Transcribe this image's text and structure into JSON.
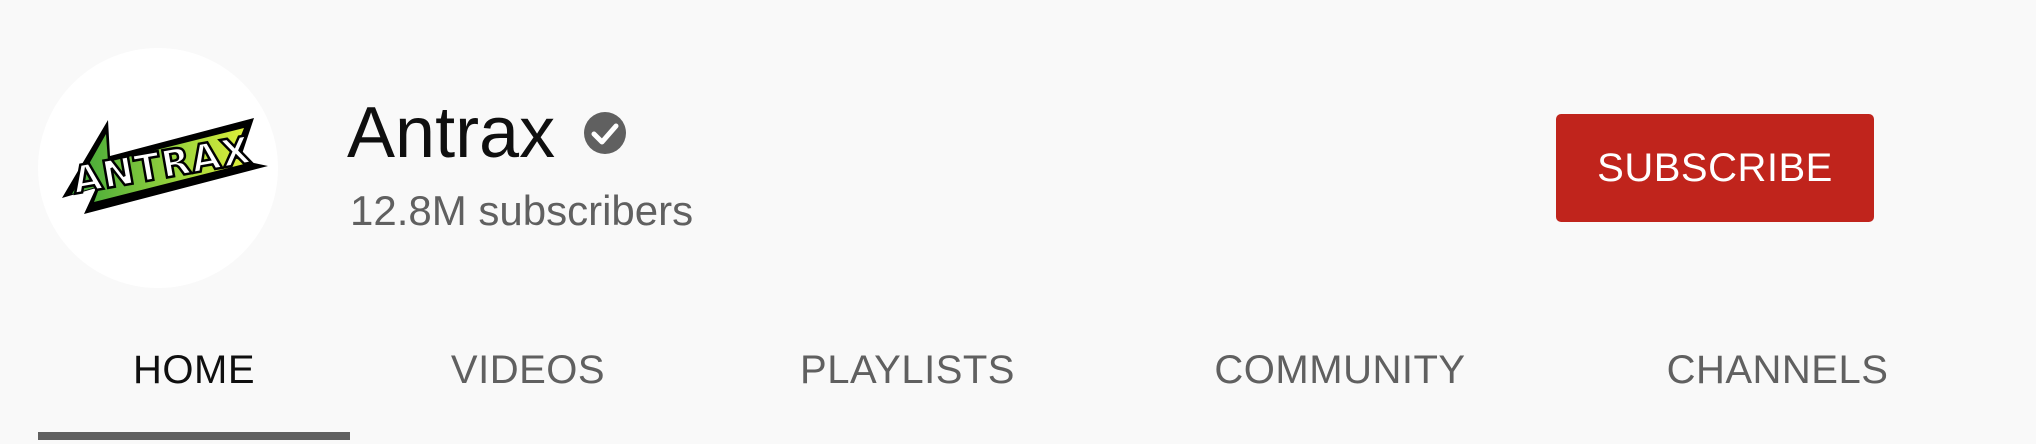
{
  "channel": {
    "name": "Antrax",
    "subscribers": "12.8M subscribers",
    "logo_text": "ANTRAX",
    "verified_icon": "verified-check-icon"
  },
  "subscribe": {
    "label": "SUBSCRIBE",
    "color": "#c0241c"
  },
  "tabs": [
    {
      "label": "HOME",
      "active": true
    },
    {
      "label": "VIDEOS",
      "active": false
    },
    {
      "label": "PLAYLISTS",
      "active": false
    },
    {
      "label": "COMMUNITY",
      "active": false
    },
    {
      "label": "CHANNELS",
      "active": false
    }
  ],
  "colors": {
    "background": "#f9f9f9",
    "text_primary": "#0f0f0f",
    "text_secondary": "#606060",
    "logo_green": "#7ecb3a"
  }
}
